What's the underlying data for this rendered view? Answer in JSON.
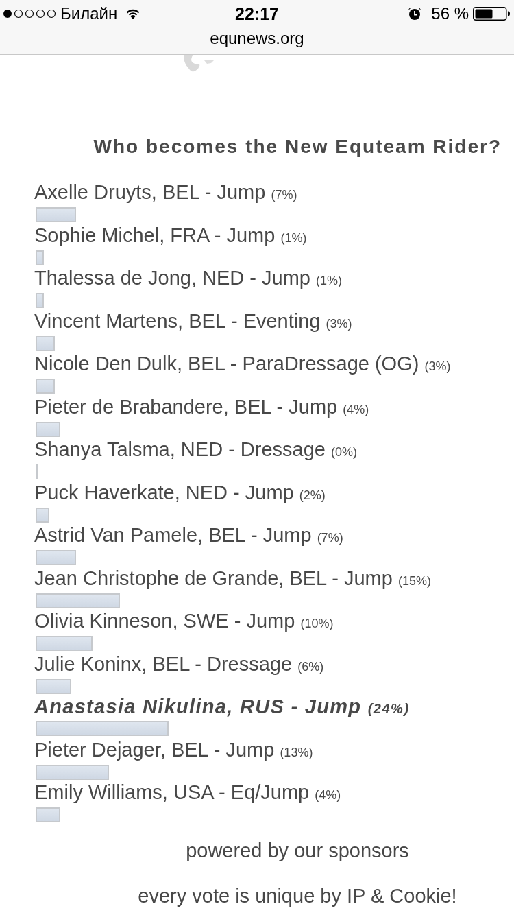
{
  "status_bar": {
    "carrier": "Билайн",
    "time": "22:17",
    "battery": "56 %"
  },
  "address_bar": {
    "url": "equnews.org"
  },
  "poll": {
    "question": "Who becomes the New Equteam Rider?",
    "answers": [
      {
        "label": "Axelle Druyts, BEL - Jump",
        "percent": "(7%)",
        "level": 0.07,
        "selected": false
      },
      {
        "label": "Sophie Michel, FRA - Jump",
        "percent": "(1%)",
        "level": 0.01,
        "selected": false
      },
      {
        "label": "Thalessa de Jong, NED - Jump",
        "percent": "(1%)",
        "level": 0.01,
        "selected": false
      },
      {
        "label": "Vincent Martens, BEL - Eventing",
        "percent": "(3%)",
        "level": 0.03,
        "selected": false
      },
      {
        "label": "Nicole Den Dulk, BEL - ParaDressage (OG)",
        "percent": "(3%)",
        "level": 0.03,
        "selected": false
      },
      {
        "label": "Pieter de Brabandere, BEL - Jump",
        "percent": "(4%)",
        "level": 0.04,
        "selected": false
      },
      {
        "label": "Shanya Talsma, NED - Dressage",
        "percent": "(0%)",
        "level": 0,
        "selected": false
      },
      {
        "label": "Puck Haverkate, NED - Jump",
        "percent": "(2%)",
        "level": 0.02,
        "selected": false
      },
      {
        "label": "Astrid Van Pamele, BEL - Jump",
        "percent": "(7%)",
        "level": 0.07,
        "selected": false
      },
      {
        "label": "Jean Christophe de Grande, BEL - Jump",
        "percent": "(15%)",
        "level": 0.15,
        "selected": false
      },
      {
        "label": "Olivia Kinneson, SWE - Jump",
        "percent": "(10%)",
        "level": 0.1,
        "selected": false
      },
      {
        "label": "Julie Koninx, BEL - Dressage",
        "percent": "(6%)",
        "level": 0.06,
        "selected": false
      },
      {
        "label": "Anastasia Nikulina, RUS - Jump",
        "percent": "(24%)",
        "level": 0.24,
        "selected": true
      },
      {
        "label": "Pieter Dejager, BEL - Jump",
        "percent": "(13%)",
        "level": 0.13,
        "selected": false
      },
      {
        "label": "Emily Williams, USA - Eq/Jump",
        "percent": "(4%)",
        "level": 0.04,
        "selected": false
      }
    ]
  },
  "footer": {
    "lines": [
      "powered by our sponsors",
      "every vote is unique by IP & Cookie!"
    ]
  }
}
